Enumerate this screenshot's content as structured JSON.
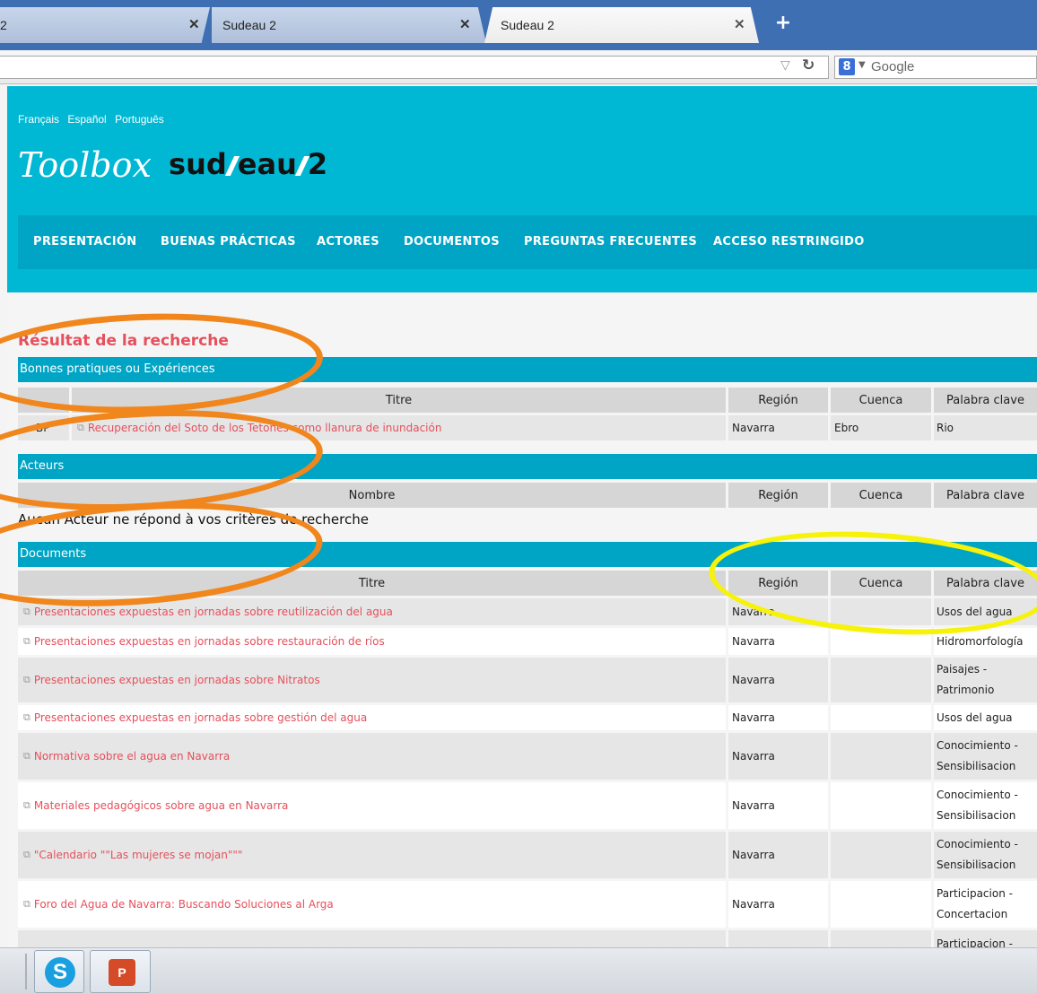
{
  "browser": {
    "tabs": [
      {
        "title": "2",
        "close": "✕"
      },
      {
        "title": "Sudeau 2",
        "close": "✕"
      },
      {
        "title": "Sudeau 2",
        "close": "✕"
      }
    ],
    "new_tab": "+",
    "search_engine": "Google",
    "search_icon_letter": "8"
  },
  "site": {
    "languages": [
      "Français",
      "Español",
      "Português"
    ],
    "logo_script": "Toolbox",
    "logo_left": "sud",
    "logo_mid": "eau",
    "logo_right": "2",
    "menu": [
      "PRESENTACIÓN",
      "BUENAS PRÁCTICAS",
      "ACTORES",
      "DOCUMENTOS",
      "PREGUNTAS FRECUENTES",
      "ACCESO RESTRINGIDO"
    ]
  },
  "results": {
    "title": "Résultat de la recherche",
    "practices": {
      "heading": "Bonnes pratiques ou Expériences",
      "columns": [
        "Titre",
        "Región",
        "Cuenca",
        "Palabra clave"
      ],
      "rows": [
        {
          "code": "BP",
          "title": "Recuperación del Soto de los Tetones como llanura de inundación",
          "region": "Navarra",
          "cuenca": "Ebro",
          "keyword": "Rio"
        }
      ]
    },
    "actors": {
      "heading": "Acteurs",
      "columns": [
        "Nombre",
        "Región",
        "Cuenca",
        "Palabra clave"
      ],
      "empty_message": "Aucun Acteur ne répond à vos critères de recherche"
    },
    "documents": {
      "heading": "Documents",
      "columns": [
        "Titre",
        "Región",
        "Cuenca",
        "Palabra clave"
      ],
      "rows": [
        {
          "title": "Presentaciones expuestas en jornadas sobre reutilización del agua",
          "region": "Navarra",
          "cuenca": "",
          "keyword": "Usos del agua"
        },
        {
          "title": "Presentaciones expuestas en jornadas sobre restauración de ríos",
          "region": "Navarra",
          "cuenca": "",
          "keyword": "Hidromorfología"
        },
        {
          "title": "Presentaciones expuestas en jornadas sobre Nitratos",
          "region": "Navarra",
          "cuenca": "",
          "keyword": "Paisajes - Patrimonio"
        },
        {
          "title": "Presentaciones expuestas en jornadas sobre gestión del agua",
          "region": "Navarra",
          "cuenca": "",
          "keyword": "Usos del agua"
        },
        {
          "title": "Normativa sobre el agua en Navarra",
          "region": "Navarra",
          "cuenca": "",
          "keyword": "Conocimiento - Sensibilisacion"
        },
        {
          "title": "Materiales pedagógicos sobre agua en Navarra",
          "region": "Navarra",
          "cuenca": "",
          "keyword": "Conocimiento - Sensibilisacion"
        },
        {
          "title": "\"Calendario \"\"Las mujeres se mojan\"\"\"",
          "region": "Navarra",
          "cuenca": "",
          "keyword": "Conocimiento - Sensibilisacion"
        },
        {
          "title": "Foro del Agua de Navarra: Buscando Soluciones al Arga",
          "region": "Navarra",
          "cuenca": "",
          "keyword": "Participacion - Concertacion"
        },
        {
          "title": "",
          "region": "",
          "cuenca": "",
          "keyword": "Participacion -"
        }
      ]
    }
  },
  "taskbar": {
    "skype_letter": "S",
    "ppt_letter": "P"
  },
  "colors": {
    "header_bg": "#00b8d4",
    "menu_bg": "#00a5c6",
    "link": "#e5505c",
    "annotation_orange": "#f0861c",
    "annotation_yellow": "#f6f20a"
  }
}
